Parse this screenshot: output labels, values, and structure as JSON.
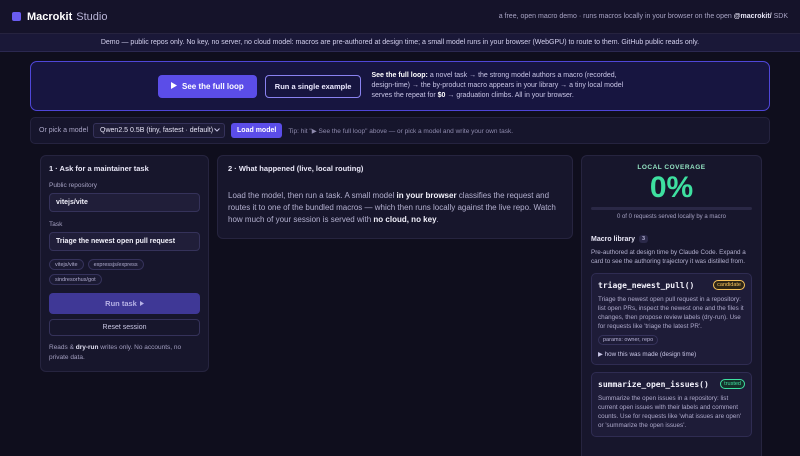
{
  "header": {
    "brand": "Macrokit",
    "brand_sub": "Studio",
    "tagline_prefix": "a free, open macro demo · runs macros locally in your browser on the open ",
    "tagline_sdk": "@macrokit/",
    "tagline_suffix": " SDK"
  },
  "banner": {
    "text": "Demo — public repos only. No key, no server, no cloud model: macros are pre-authored at design time; a small model runs in your browser (WebGPU) to route to them. GitHub public reads only."
  },
  "hero": {
    "primary_label": "See the full loop",
    "secondary_label": "Run a single example",
    "text_bold": "See the full loop:",
    "text_1": " a novel task → the strong model authors a macro (recorded, design-time) → the by-product macro appears in your library → a tiny local model serves the repeat for ",
    "text_cost": "$0",
    "text_2": " → graduation climbs. All in your browser."
  },
  "model_row": {
    "pick_label": "Or pick a model",
    "selected_model": "Qwen2.5 0.5B (tiny, fastest · default)",
    "load_label": "Load model",
    "tip": "Tip: hit \"▶ See the full loop\" above — or pick a model and write your own task."
  },
  "ask_panel": {
    "title": "1 · Ask for a maintainer task",
    "repo_label": "Public repository",
    "repo_value": "vitejs/vite",
    "task_label": "Task",
    "task_value": "Triage the newest open pull request",
    "chips": [
      "vitejs/vite",
      "expressjs/express",
      "sindresorhus/got"
    ],
    "run_label": "Run task",
    "reset_label": "Reset session",
    "foot_1": "Reads & ",
    "foot_bold": "dry-run",
    "foot_2": " writes only. No accounts, no private data."
  },
  "happened_panel": {
    "title": "2 · What happened (live, local routing)",
    "body_1": "Load the model, then run a task. A small model ",
    "body_bold_1": "in your browser",
    "body_2": " classifies the request and routes it to one of the bundled macros — which then runs locally against the live repo. Watch how much of your session is served with ",
    "body_bold_2": "no cloud, no key",
    "body_3": "."
  },
  "coverage_panel": {
    "title": "LOCAL COVERAGE",
    "percent": "0%",
    "fraction": 0,
    "sub": "0 of 0 requests served locally by a macro",
    "library_title": "Macro library",
    "library_count": "3",
    "library_desc": "Pre-authored at design time by Claude Code. Expand a card to see the authoring trajectory it was distilled from.",
    "macros": [
      {
        "name": "triage_newest_pull()",
        "badge": "candidate",
        "desc": "Triage the newest open pull request in a repository: list open PRs, inspect the newest one and the files it changes, then propose review labels (dry-run). Use for requests like 'triage the latest PR'.",
        "params": "params: owner, repo",
        "how": "▶ how this was made (design time)"
      },
      {
        "name": "summarize_open_issues()",
        "badge": "trusted",
        "desc": "Summarize the open issues in a repository: list current open issues with their labels and comment counts. Use for requests like 'what issues are open' or 'summarize the open issues'."
      }
    ]
  },
  "colors": {
    "accent": "#5b4de8",
    "coverage_green": "#3ee0a0",
    "candidate": "#f7c35a",
    "background": "#0f0e1d"
  }
}
